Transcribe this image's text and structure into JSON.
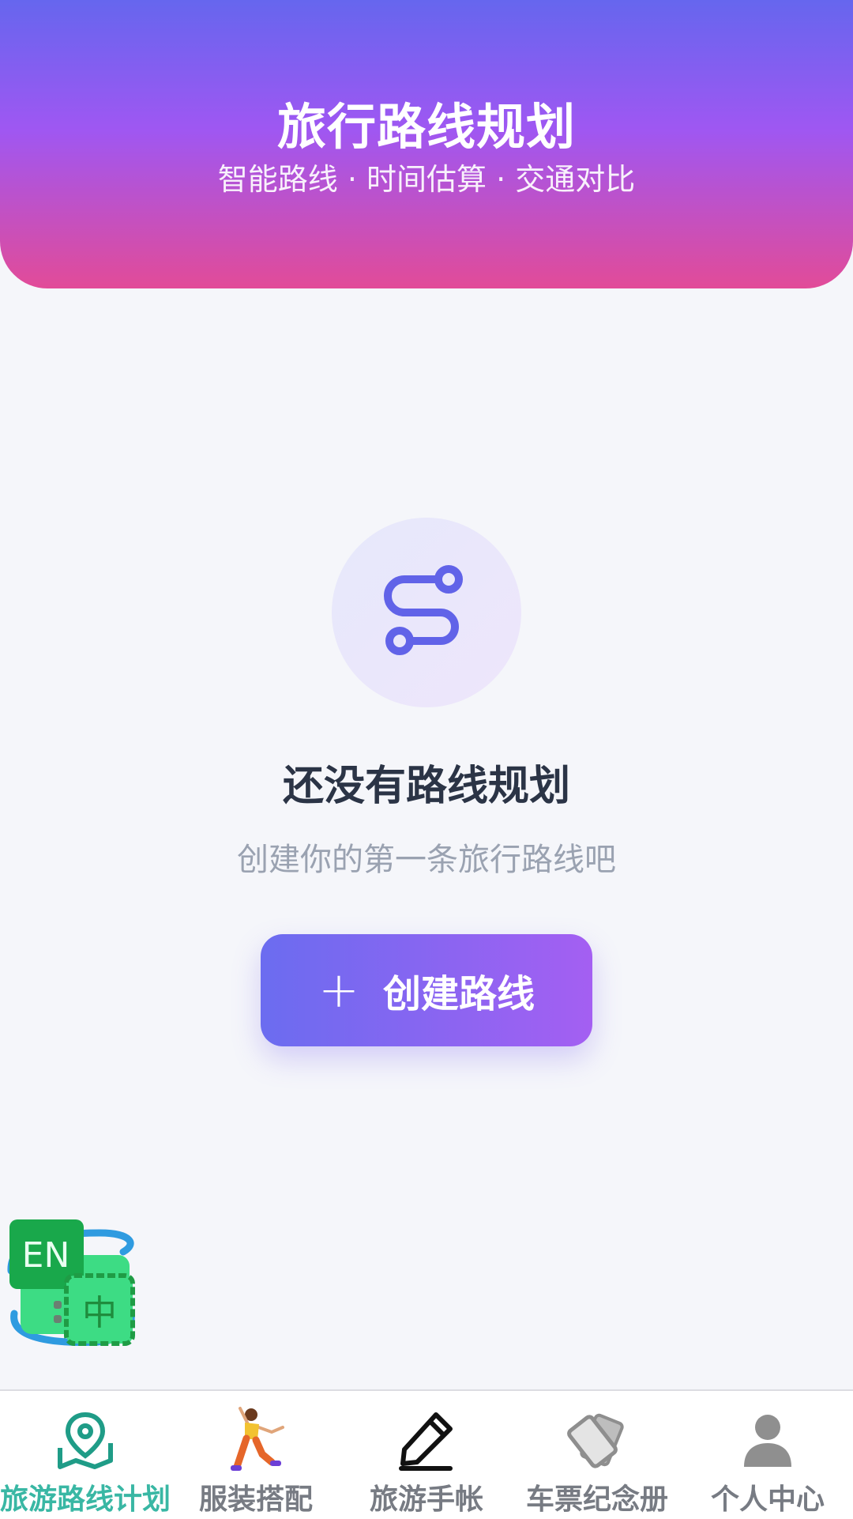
{
  "header": {
    "title": "旅行路线规划",
    "subtitle": "智能路线 · 时间估算 · 交通对比"
  },
  "empty_state": {
    "icon": "route-icon",
    "title": "还没有路线规划",
    "description": "创建你的第一条旅行路线吧"
  },
  "create_button": {
    "icon": "plus-icon",
    "label": "创建路线"
  },
  "language_toggle": {
    "labels": [
      "EN",
      "中"
    ]
  },
  "tabbar": {
    "items": [
      {
        "label": "旅游路线计划",
        "icon": "map-pin-icon",
        "active": true
      },
      {
        "label": "服装搭配",
        "icon": "dancer-icon",
        "active": false
      },
      {
        "label": "旅游手帐",
        "icon": "pencil-icon",
        "active": false
      },
      {
        "label": "车票纪念册",
        "icon": "ticket-cards-icon",
        "active": false
      },
      {
        "label": "个人中心",
        "icon": "user-icon",
        "active": false
      }
    ]
  },
  "colors": {
    "header_gradient": [
      "#6666ee",
      "#9f57f2",
      "#e24b98"
    ],
    "accent": "#6b6cf0",
    "active_tab": "#39b7a4",
    "inactive_tab": "#777b83"
  }
}
